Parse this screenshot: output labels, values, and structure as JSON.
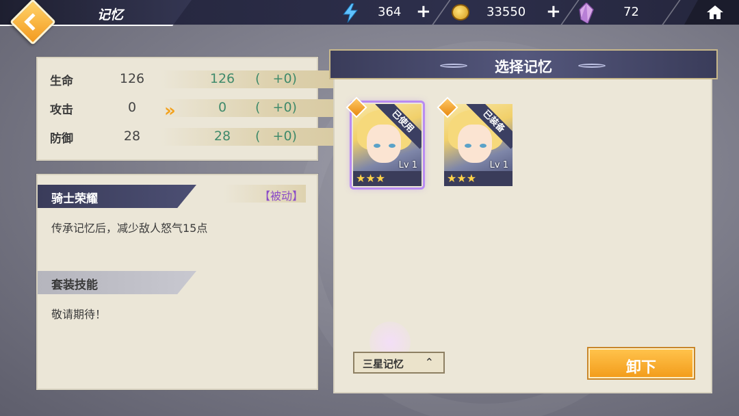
{
  "header": {
    "title": "记忆",
    "resources": [
      {
        "name": "energy",
        "icon": "lightning-icon",
        "value": "364"
      },
      {
        "name": "coin",
        "icon": "coin-icon",
        "value": "33550"
      },
      {
        "name": "crystal",
        "icon": "crystal-icon",
        "value": "72"
      }
    ],
    "plus": "+"
  },
  "stats": [
    {
      "label": "生命",
      "current": "126",
      "new": "126",
      "diff": "(   +0)"
    },
    {
      "label": "攻击",
      "current": "0",
      "new": "0",
      "diff": "(   +0)"
    },
    {
      "label": "防御",
      "current": "28",
      "new": "28",
      "diff": "(   +0)"
    }
  ],
  "stats_arrow": "»",
  "skill": {
    "name": "骑士荣耀",
    "tag": "【被动】",
    "description": "传承记忆后，减少敌人怒气15点"
  },
  "set_skill": {
    "name": "套装技能",
    "description": "敬请期待！"
  },
  "select_panel": {
    "title": "选择记忆",
    "cards": [
      {
        "ribbon": "已使用",
        "level": "Lv 1",
        "stars": "★★★",
        "selected": true
      },
      {
        "ribbon": "已装备",
        "level": "Lv 1",
        "stars": "★★★",
        "selected": false
      }
    ],
    "filter_label": "三星记忆",
    "filter_chevron": "⌃",
    "unload_label": "卸下"
  },
  "colors": {
    "accent": "#f39d1c",
    "panel": "#ebe6d7",
    "header": "#3a3c5a",
    "positive": "#3f8a6b",
    "passive_tag": "#8a4bc8"
  }
}
